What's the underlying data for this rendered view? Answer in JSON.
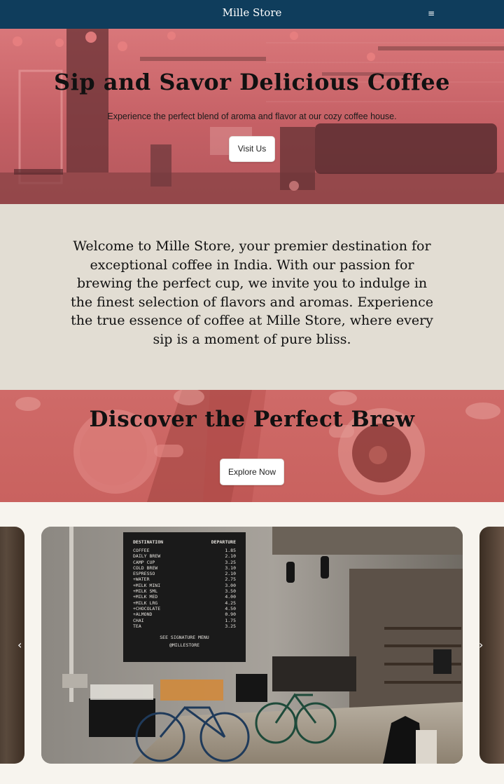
{
  "header": {
    "brand": "Mille Store",
    "menu_icon": "hamburger-icon",
    "menu_glyph": "≡",
    "bg_color": "#0f3d5c"
  },
  "hero": {
    "title": "Sip and Savor Delicious Coffee",
    "subtitle": "Experience the perfect blend of aroma and flavor at our cozy coffee house.",
    "button_label": "Visit Us",
    "overlay_color": "#d9777a"
  },
  "welcome": {
    "text": "Welcome to Mille Store, your premier destination for exceptional coffee in India. With our passion for brewing the perfect cup, we invite you to indulge in the finest selection of flavors and aromas. Experience the true essence of coffee at Mille Store, where every sip is a moment of pure bliss.",
    "bg_color": "#e2ddd3"
  },
  "discover": {
    "title": "Discover the Perfect Brew",
    "button_label": "Explore Now",
    "overlay_color": "#cf6a68"
  },
  "carousel": {
    "prev_icon": "chevron-left-icon",
    "next_icon": "chevron-right-icon",
    "prev_glyph": "‹",
    "next_glyph": "›",
    "board": {
      "header_left": "DESTINATION",
      "header_right": "DEPARTURE",
      "items": [
        "COFFEE",
        "DAILY BREW",
        "CAMP CUP",
        "COLD BREW",
        "ESPRESSO",
        "+WATER",
        "+MILK MINI",
        "+MILK SML",
        "+MILK MED",
        "+MILK LRG",
        "+CHOCOLATE",
        "+ALMOND",
        "CHAI",
        "TEA"
      ],
      "prices": [
        "1.85",
        "2.10",
        "3.25",
        "3.10",
        "2.10",
        "2.75",
        "3.00",
        "3.50",
        "4.00",
        "4.25",
        "4.50",
        "0.90",
        "1.75",
        "3.25"
      ],
      "footer": "SEE SIGNATURE MENU",
      "handle": "@MILLESTORE"
    }
  }
}
